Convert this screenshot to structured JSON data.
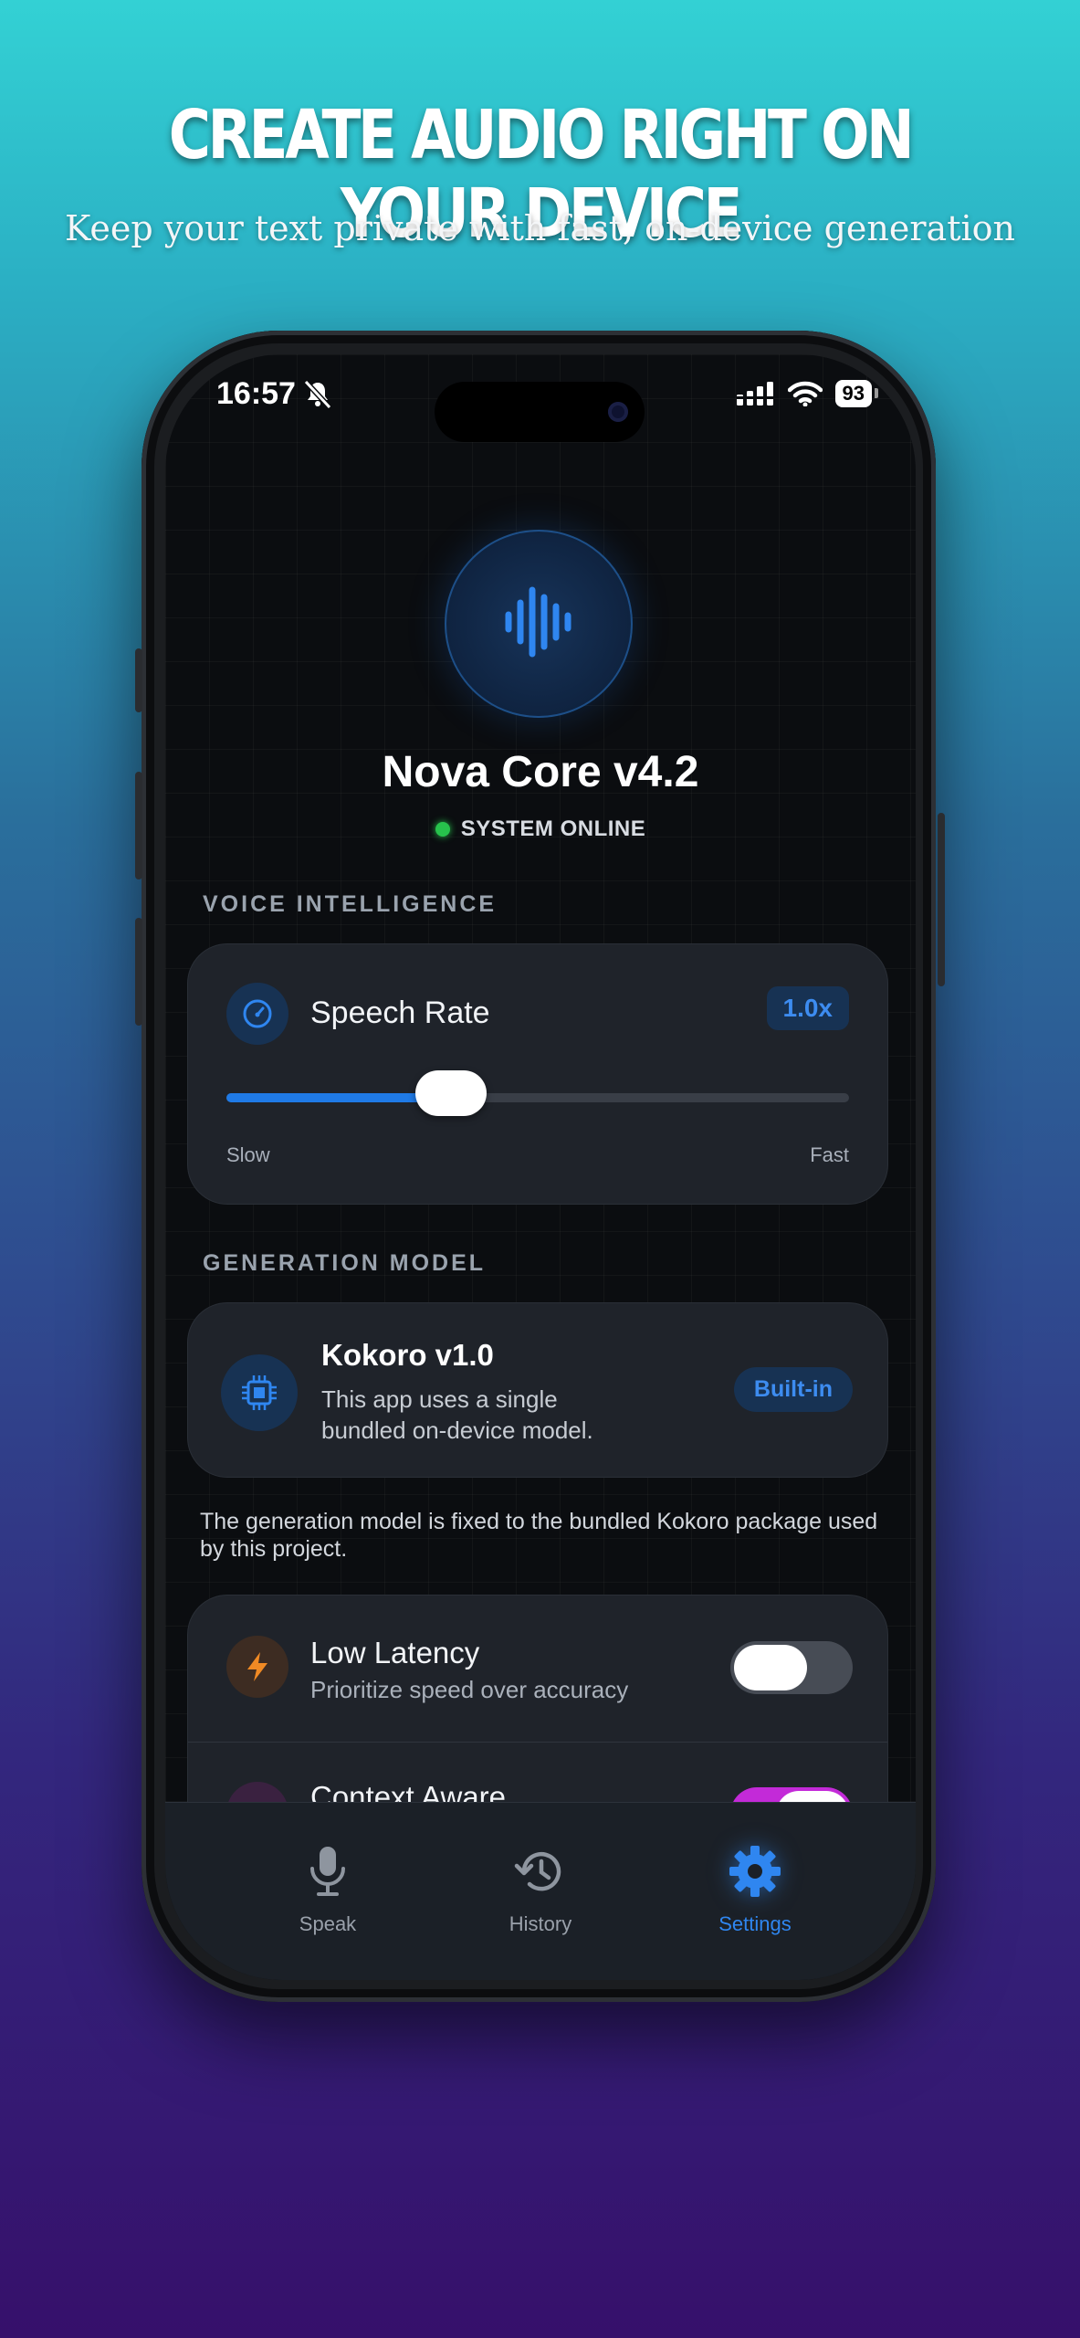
{
  "promo": {
    "headline": "CREATE AUDIO RIGHT ON YOUR DEVICE",
    "subheadline": "Keep your text private with fast, on-device generation"
  },
  "status_bar": {
    "time": "16:57",
    "battery": "93"
  },
  "header": {
    "title": "Nova Core v4.2",
    "status": "SYSTEM ONLINE",
    "status_color": "#27c24c"
  },
  "voice_intelligence": {
    "section_title": "VOICE INTELLIGENCE",
    "speech_rate": {
      "label": "Speech Rate",
      "value": "1.0x",
      "slider_fraction": 0.36,
      "min_label": "Slow",
      "max_label": "Fast"
    }
  },
  "generation_model": {
    "section_title": "GENERATION MODEL",
    "model_name": "Kokoro v1.0",
    "model_description": "This app uses a single bundled on-device model.",
    "badge": "Built-in",
    "note": "The generation model is fixed to the bundled Kokoro package used by this project."
  },
  "toggles": [
    {
      "label": "Low Latency",
      "subtitle": "Prioritize speed over accuracy",
      "on": false,
      "icon": "lightning-icon"
    },
    {
      "label": "Context Aware",
      "on": true,
      "icon": "context-icon"
    }
  ],
  "tabs": [
    {
      "label": "Speak",
      "icon": "microphone-icon",
      "active": false
    },
    {
      "label": "History",
      "icon": "history-icon",
      "active": false
    },
    {
      "label": "Settings",
      "icon": "gear-icon",
      "active": true
    }
  ],
  "colors": {
    "accent": "#1f7ae6",
    "toggle_on": "#c32ad8",
    "lightning": "#f08a24"
  }
}
